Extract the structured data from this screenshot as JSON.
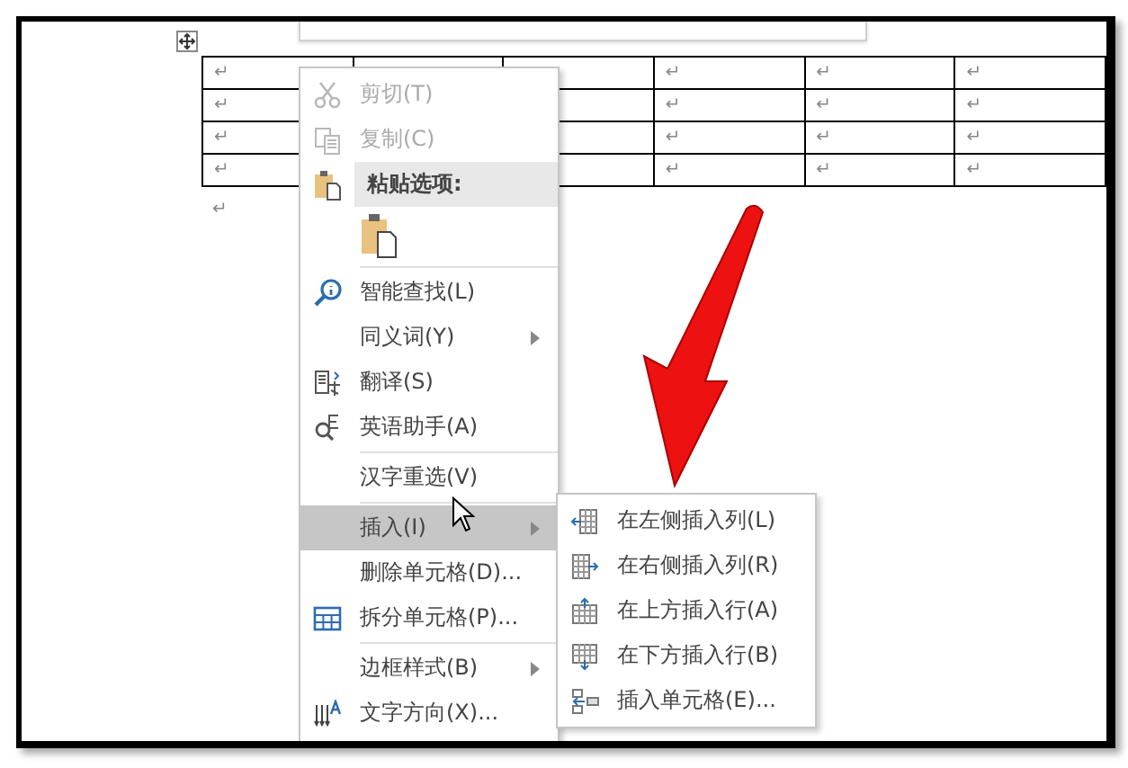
{
  "table": {
    "rows": [
      {
        "cells": [
          {
            "mark": "↵"
          },
          {},
          {},
          {
            "mark": "↵"
          },
          {
            "mark": "↵"
          },
          {
            "mark": "↵"
          }
        ]
      },
      {
        "cells": [
          {
            "mark": "↵"
          },
          {},
          {},
          {
            "mark": "↵"
          },
          {
            "mark": "↵"
          },
          {
            "mark": "↵"
          }
        ]
      },
      {
        "cells": [
          {
            "mark": "↵"
          },
          {},
          {},
          {
            "mark": "↵"
          },
          {
            "mark": "↵"
          },
          {
            "mark": "↵"
          }
        ]
      },
      {
        "cells": [
          {
            "mark": "↵"
          },
          {},
          {},
          {
            "mark": "↵"
          },
          {
            "mark": "↵"
          },
          {
            "mark": "↵"
          }
        ]
      }
    ],
    "after_mark": "↵"
  },
  "context_menu": {
    "items": [
      {
        "kind": "item",
        "label": "剪切(T)",
        "disabled": true,
        "selected": false,
        "submenu": false
      },
      {
        "kind": "item",
        "label": "复制(C)",
        "disabled": true,
        "selected": false,
        "submenu": false
      },
      {
        "kind": "header",
        "label": "粘贴选项:"
      },
      {
        "kind": "paste"
      },
      {
        "kind": "separator"
      },
      {
        "kind": "item",
        "label": "智能查找(L)",
        "disabled": false,
        "selected": false,
        "submenu": false
      },
      {
        "kind": "item",
        "label": "同义词(Y)",
        "disabled": false,
        "selected": false,
        "submenu": true
      },
      {
        "kind": "item",
        "label": "翻译(S)",
        "disabled": false,
        "selected": false,
        "submenu": false
      },
      {
        "kind": "item",
        "label": "英语助手(A)",
        "disabled": false,
        "selected": false,
        "submenu": false
      },
      {
        "kind": "separator"
      },
      {
        "kind": "item",
        "label": "汉字重选(V)",
        "disabled": false,
        "selected": false,
        "submenu": false
      },
      {
        "kind": "separator"
      },
      {
        "kind": "item",
        "label": "插入(I)",
        "disabled": false,
        "selected": true,
        "submenu": true
      },
      {
        "kind": "item",
        "label": "删除单元格(D)...",
        "disabled": false,
        "selected": false,
        "submenu": false
      },
      {
        "kind": "item",
        "label": "拆分单元格(P)...",
        "disabled": false,
        "selected": false,
        "submenu": false
      },
      {
        "kind": "separator"
      },
      {
        "kind": "item",
        "label": "边框样式(B)",
        "disabled": false,
        "selected": false,
        "submenu": true
      },
      {
        "kind": "item",
        "label": "文字方向(X)...",
        "disabled": false,
        "selected": false,
        "submenu": false
      },
      {
        "kind": "partial"
      }
    ]
  },
  "insert_submenu": {
    "items": [
      {
        "kind": "item",
        "label": "在左侧插入列(L)",
        "disabled": false,
        "selected": false,
        "submenu": false
      },
      {
        "kind": "item",
        "label": "在右侧插入列(R)",
        "disabled": false,
        "selected": false,
        "submenu": false
      },
      {
        "kind": "item",
        "label": "在上方插入行(A)",
        "disabled": false,
        "selected": false,
        "submenu": false
      },
      {
        "kind": "item",
        "label": "在下方插入行(B)",
        "disabled": false,
        "selected": false,
        "submenu": false
      },
      {
        "kind": "item",
        "label": "插入单元格(E)...",
        "disabled": false,
        "selected": false,
        "submenu": false
      }
    ]
  }
}
